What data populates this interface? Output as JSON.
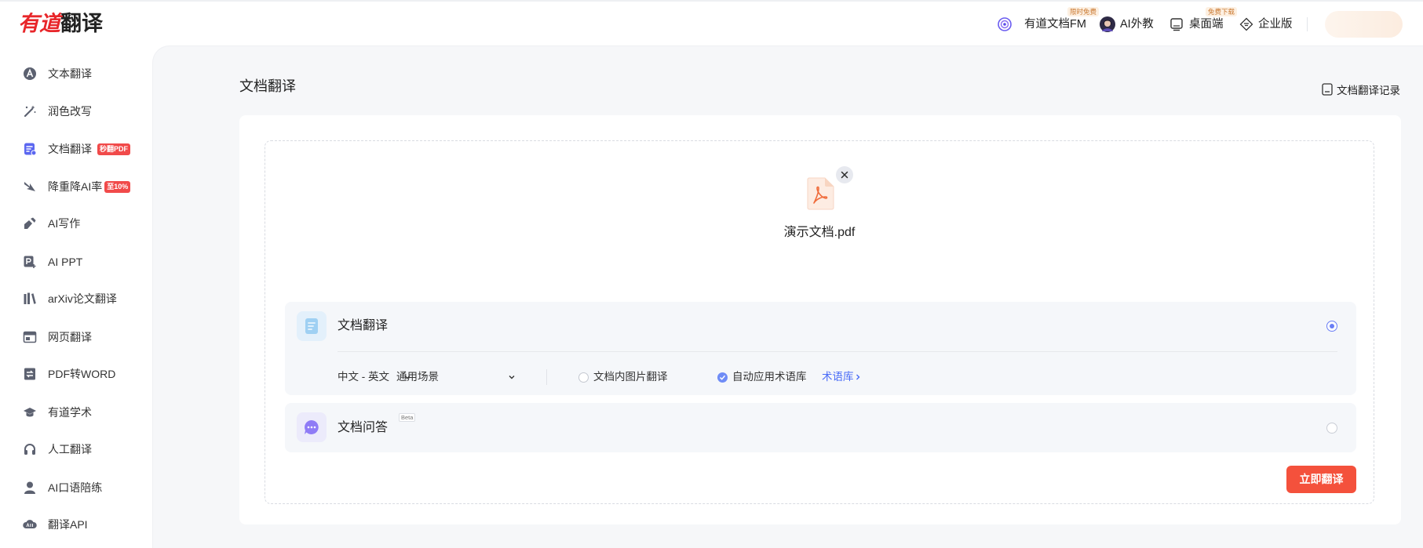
{
  "header": {
    "logo": {
      "part1": "有道",
      "part2": "翻译"
    },
    "nav": [
      {
        "label": "有道文档FM",
        "badge": "限时免费",
        "icon": "podcast-icon"
      },
      {
        "label": "AI外教",
        "icon": "avatar"
      },
      {
        "label": "桌面端",
        "badge": "免费下载",
        "icon": "monitor-icon"
      },
      {
        "label": "企业版",
        "icon": "enterprise-icon"
      }
    ]
  },
  "sidebar": {
    "items": [
      {
        "label": "文本翻译",
        "icon": "text-translate-icon"
      },
      {
        "label": "润色改写",
        "icon": "magic-wand-icon"
      },
      {
        "label": "文档翻译",
        "icon": "document-translate-icon",
        "badge": "秒翻PDF",
        "active": true
      },
      {
        "label": "降重降AI率",
        "icon": "reduce-icon",
        "badge": "至10%"
      },
      {
        "label": "AI写作",
        "icon": "ai-write-icon"
      },
      {
        "label": "AI PPT",
        "icon": "ai-ppt-icon"
      },
      {
        "label": "arXiv论文翻译",
        "icon": "books-icon"
      },
      {
        "label": "网页翻译",
        "icon": "webpage-icon"
      },
      {
        "label": "PDF转WORD",
        "icon": "pdf-to-word-icon"
      },
      {
        "label": "有道学术",
        "icon": "graduation-cap-icon"
      },
      {
        "label": "人工翻译",
        "icon": "headset-icon"
      },
      {
        "label": "AI口语陪练",
        "icon": "person-icon"
      },
      {
        "label": "翻译API",
        "icon": "api-icon"
      }
    ]
  },
  "main": {
    "title": "文档翻译",
    "history_link": "文档翻译记录",
    "file": {
      "name": "演示文档.pdf"
    },
    "options": [
      {
        "title": "文档翻译",
        "selected": true,
        "language_pair": "中文 - 英文",
        "scene": "通用场景",
        "image_translate": {
          "label": "文档内图片翻译",
          "checked": false
        },
        "auto_glossary": {
          "label": "自动应用术语库",
          "checked": true
        },
        "glossary_link": "术语库"
      },
      {
        "title": "文档问答",
        "tag": "Beta",
        "selected": false
      }
    ],
    "submit_label": "立即翻译"
  },
  "colors": {
    "brand_red": "#e8262a",
    "accent": "#6a7ef5",
    "link": "#4a6cf7",
    "submit_button": "#f4513c",
    "badge_red": "#f14a4a"
  }
}
